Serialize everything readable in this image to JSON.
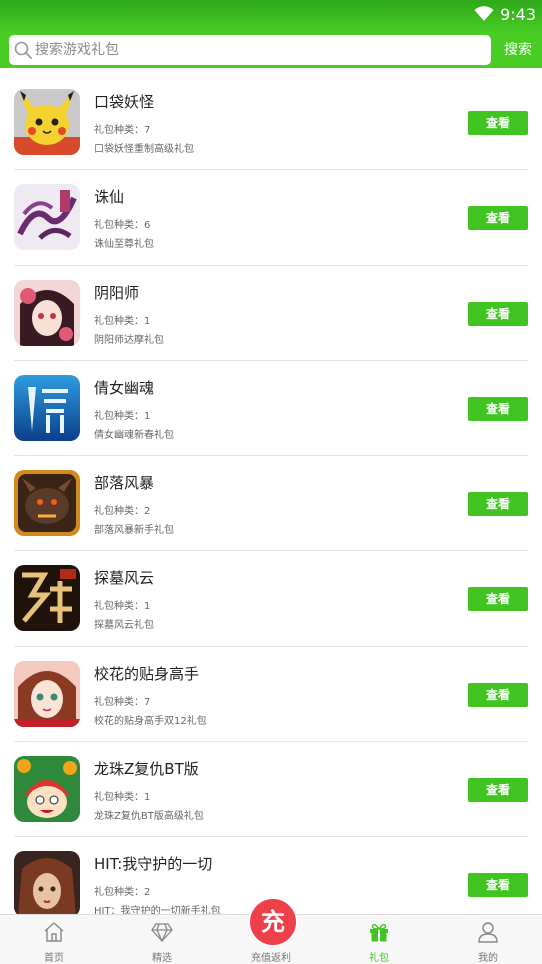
{
  "status_bar": {
    "time": "9:43"
  },
  "search": {
    "placeholder": "搜索游戏礼包",
    "button_label": "搜索"
  },
  "games": [
    {
      "name": "口袋妖怪",
      "gift_count": "礼包种类：7",
      "description": "口袋妖怪重制高级礼包",
      "button": "查看",
      "icon": "pikachu-icon"
    },
    {
      "name": "诛仙",
      "gift_count": "礼包种类：6",
      "description": "诛仙至尊礼包",
      "button": "查看",
      "icon": "zhuxian-icon"
    },
    {
      "name": "阴阳师",
      "gift_count": "礼包种类：1",
      "description": "阴阳师达摩礼包",
      "button": "查看",
      "icon": "onmyoji-icon"
    },
    {
      "name": "倩女幽魂",
      "gift_count": "礼包种类：1",
      "description": "倩女幽魂新春礼包",
      "button": "查看",
      "icon": "qiannv-icon"
    },
    {
      "name": "部落风暴",
      "gift_count": "礼包种类：2",
      "description": "部落风暴新手礼包",
      "button": "查看",
      "icon": "dragon-icon"
    },
    {
      "name": "探墓风云",
      "gift_count": "礼包种类：1",
      "description": "探墓风云礼包",
      "button": "查看",
      "icon": "tanmu-icon"
    },
    {
      "name": "校花的贴身高手",
      "gift_count": "礼包种类：7",
      "description": "校花的贴身高手双12礼包",
      "button": "查看",
      "icon": "schoolgirl-icon"
    },
    {
      "name": "龙珠Z复仇BT版",
      "gift_count": "礼包种类：1",
      "description": "龙珠Z复仇BT版高级礼包",
      "button": "查看",
      "icon": "dragonball-icon"
    },
    {
      "name": "HIT:我守护的一切",
      "gift_count": "礼包种类：2",
      "description": "HIT：我守护的一切新手礼包",
      "button": "查看",
      "icon": "hit-icon"
    }
  ],
  "tabs": {
    "home": "首页",
    "featured": "精选",
    "recharge_badge": "充",
    "recharge": "充值返利",
    "gift": "礼包",
    "mine": "我的"
  },
  "colors": {
    "accent": "#49cd25",
    "button": "#3fc421",
    "recharge": "#ee3f4a"
  }
}
